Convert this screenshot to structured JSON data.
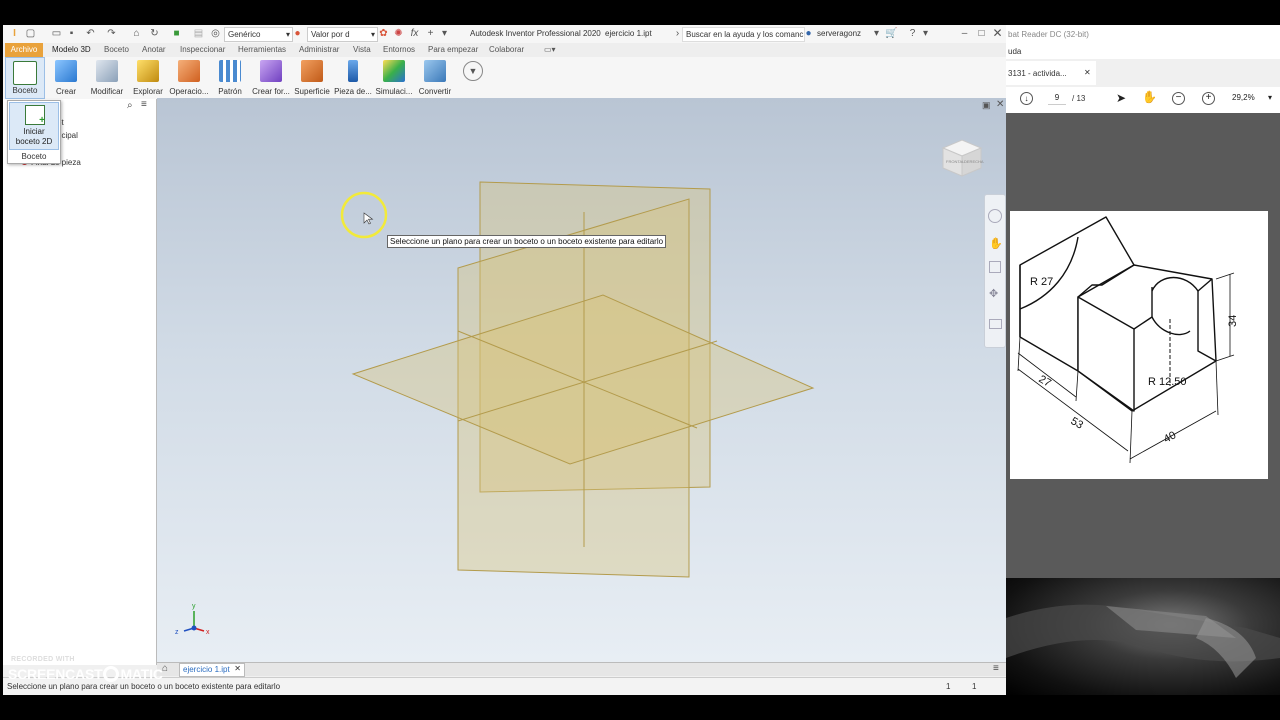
{
  "inventor": {
    "title": "Autodesk Inventor Professional 2020",
    "filename": "ejercicio 1.ipt",
    "search_placeholder": "Buscar en la ayuda y los comanc",
    "user": "serveragonz",
    "material_combo": "Genérico",
    "appearance_combo": "Valor por d",
    "menus": [
      "Archivo",
      "Modelo 3D",
      "Boceto",
      "Anotar",
      "Inspeccionar",
      "Herramientas",
      "Administrar",
      "Vista",
      "Entornos",
      "Para empezar",
      "Colaborar"
    ],
    "ribbon": [
      "Boceto",
      "Crear",
      "Modificar",
      "Explorar",
      "Operacio...",
      "Patrón",
      "Crear for...",
      "Superficie",
      "Pieza de...",
      "Simulaci...",
      "Convertir"
    ],
    "popup": {
      "line1": "Iniciar",
      "line2": "boceto 2D",
      "footer": "Boceto"
    },
    "browser_items": [
      "ot",
      "ncipal",
      "Final de pieza"
    ],
    "tooltip": "Seleccione un plano para crear un boceto o un boceto existente para editarlo",
    "status_text": "Seleccione un plano para crear un boceto o un boceto existente para editarlo",
    "status_num1": "1",
    "status_num2": "1",
    "doc_tab": "ejercicio 1.ipt",
    "viewcube_labels": [
      "FRONTAL",
      "DERECHA"
    ],
    "axes": {
      "x": "x",
      "y": "y",
      "z": "z"
    }
  },
  "acrobat": {
    "title_partial": "bat Reader DC (32-bit)",
    "menu_partial": "uda",
    "tab_label": "3131 - activida...",
    "page_current": "9",
    "page_total": "/ 13",
    "zoom": "29,2%",
    "drawing_labels": {
      "r27": "R 27",
      "dim34": "34",
      "r1250": "R 12.50",
      "dim27": "27",
      "dim53": "53",
      "dim40": "40"
    }
  },
  "watermark": {
    "line1": "RECORDED WITH",
    "line2a": "SCREENCAST",
    "line2b": "MATIC"
  },
  "colors": {
    "archivo_tab": "#e9a23b",
    "plane_fill": "#d8c27a",
    "plane_stroke": "#b39b4c",
    "highlight_circle": "#f2ea3a"
  }
}
